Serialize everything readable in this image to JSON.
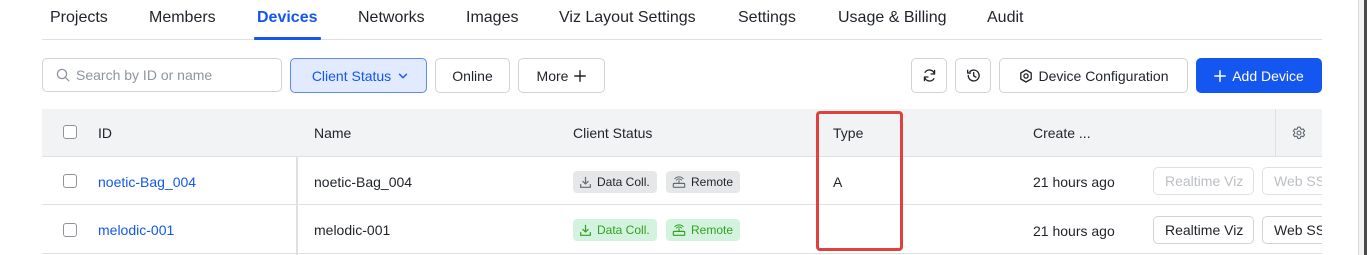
{
  "tabs": {
    "items": [
      {
        "label": "Projects"
      },
      {
        "label": "Members"
      },
      {
        "label": "Devices"
      },
      {
        "label": "Networks"
      },
      {
        "label": "Images"
      },
      {
        "label": "Viz Layout Settings"
      },
      {
        "label": "Settings"
      },
      {
        "label": "Usage & Billing"
      },
      {
        "label": "Audit"
      }
    ],
    "active": "Devices"
  },
  "toolbar": {
    "search_placeholder": "Search by ID or name",
    "search_value": "",
    "client_status_label": "Client Status",
    "online_label": "Online",
    "more_label": "More",
    "device_config_label": "Device Configuration",
    "add_device_label": "Add Device"
  },
  "table": {
    "columns": {
      "id": "ID",
      "name": "Name",
      "client_status": "Client Status",
      "type": "Type",
      "created": "Create ..."
    },
    "rows": [
      {
        "id": "noetic-Bag_004",
        "name": "noetic-Bag_004",
        "status_tags": [
          "Data Coll.",
          "Remote"
        ],
        "status_state": "offline",
        "type": "A",
        "created": "21 hours ago",
        "realtime_label": "Realtime Viz",
        "webssh_label": "Web SS",
        "actions_enabled": false
      },
      {
        "id": "melodic-001",
        "name": "melodic-001",
        "status_tags": [
          "Data Coll.",
          "Remote"
        ],
        "status_state": "online",
        "type": "",
        "created": "21 hours ago",
        "realtime_label": "Realtime Viz",
        "webssh_label": "Web SS",
        "actions_enabled": true
      }
    ]
  },
  "colors": {
    "accent": "#1456f0",
    "highlight": "#e0413e",
    "tag_online_text": "#2ea121",
    "tag_online_bg": "#d4f3de",
    "tag_offline_bg": "#e6e7e9"
  },
  "icons": {
    "search": "search-icon",
    "chevron": "chevron-down-icon",
    "plus": "plus-icon",
    "refresh": "refresh-icon",
    "history": "history-icon",
    "config": "settings-circle-icon",
    "column_settings": "gear-icon",
    "download": "download-icon",
    "remote": "remote-icon"
  }
}
